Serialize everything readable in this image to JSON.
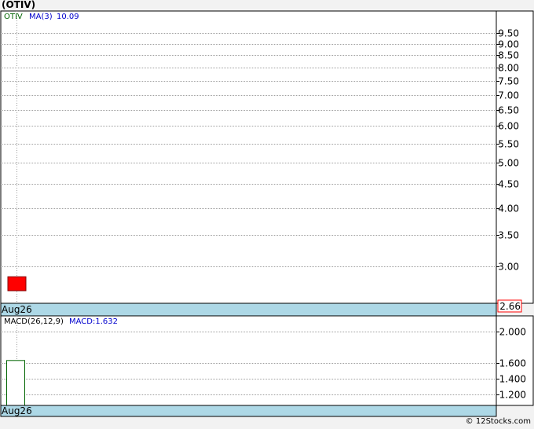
{
  "title": "(OTIV)",
  "credit": "© 12Stocks.com",
  "chart_data": [
    {
      "type": "candlestick",
      "legend": {
        "symbol": "OTIV",
        "ma_label": "MA(3)",
        "ma_value": "10.09"
      },
      "y_scale": "log",
      "ylim": [
        2.5,
        10.5
      ],
      "yticks": [
        3.0,
        3.5,
        4.0,
        4.5,
        5.0,
        5.5,
        6.0,
        6.5,
        7.0,
        7.5,
        8.0,
        8.5,
        9.0,
        9.5
      ],
      "ytick_labels": [
        "3.00",
        "3.50",
        "4.00",
        "4.50",
        "5.00",
        "5.50",
        "6.00",
        "6.50",
        "7.00",
        "7.50",
        "8.00",
        "8.50",
        "9.00",
        "9.50"
      ],
      "x_label": "Aug26",
      "last_price_label": "2.66",
      "candles": [
        {
          "date": "Aug26",
          "open": 2.85,
          "high": 2.85,
          "low": 2.66,
          "close": 2.66,
          "color": "#ff0000"
        }
      ],
      "grid": true
    },
    {
      "type": "bar",
      "legend": {
        "name": "MACD(26,12,9)",
        "value_label": "MACD:1.632"
      },
      "ylim": [
        1.06,
        2.2
      ],
      "yticks": [
        1.2,
        1.4,
        1.6,
        2.0
      ],
      "ytick_labels": [
        "1.200",
        "1.400",
        "1.600",
        "2.000"
      ],
      "x_label": "Aug26",
      "bars": [
        {
          "date": "Aug26",
          "value": 1.632
        }
      ],
      "grid": true
    }
  ],
  "colors": {
    "axis_band": "#add8e6",
    "grid": "#a0a0a0",
    "down_candle": "#ff0000",
    "macd_bar_border": "#006400",
    "legend_symbol": "#006400",
    "legend_ma": "#0000cd",
    "price_label_border": "#ff0000"
  }
}
